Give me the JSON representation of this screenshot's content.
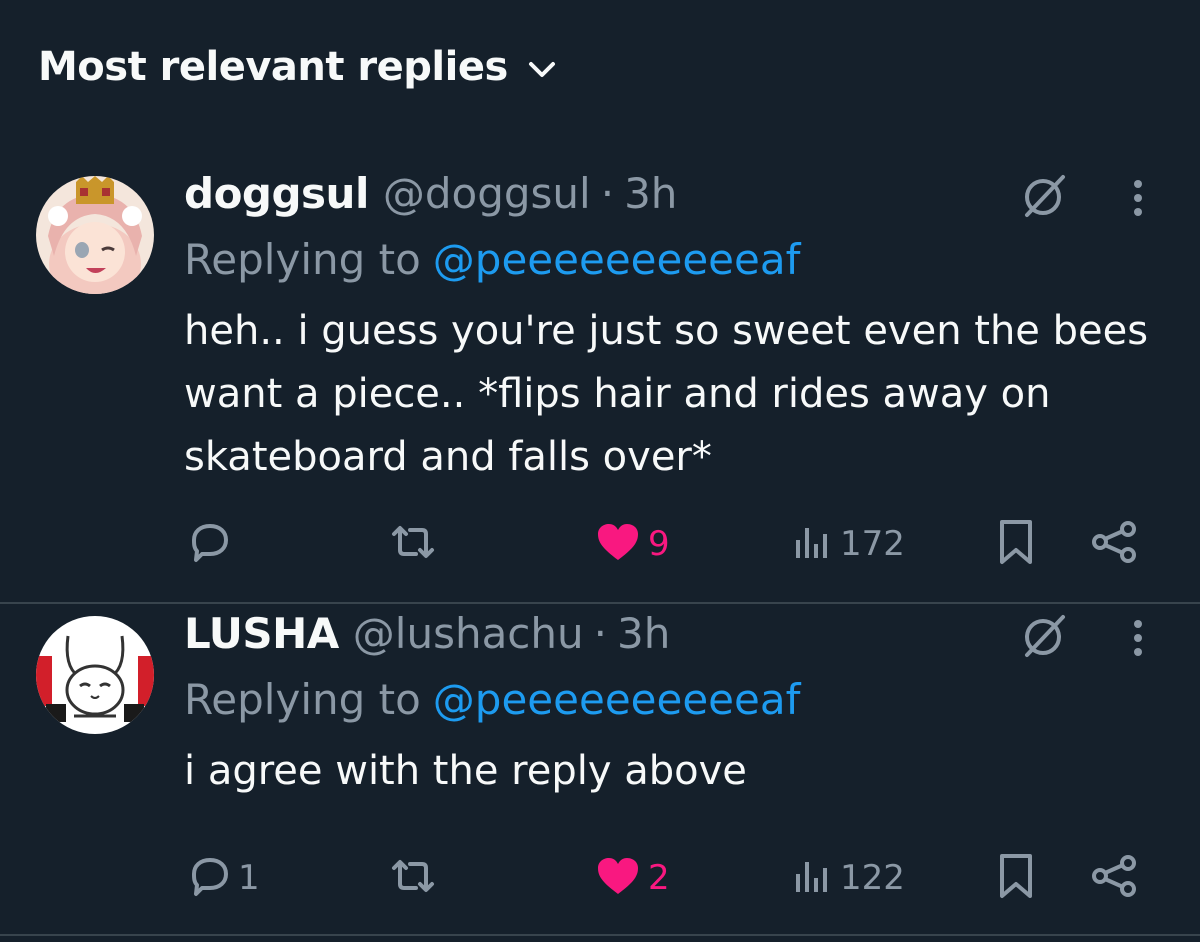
{
  "sort": {
    "label": "Most relevant replies"
  },
  "replies": [
    {
      "display_name": "doggsul",
      "handle": "@doggsul",
      "separator": "·",
      "time": "3h",
      "replying_prefix": "Replying to",
      "replying_handle": "@peeeeeeeeeeaf",
      "text": "heh.. i guess you're just so sweet even the bees want a piece.. *flips hair and rides away on skateboard and falls over*",
      "reply_count": "",
      "retweet_count": "",
      "like_count": "9",
      "view_count": "172"
    },
    {
      "display_name": "LUSHA",
      "handle": "@lushachu",
      "separator": "·",
      "time": "3h",
      "replying_prefix": "Replying to",
      "replying_handle": "@peeeeeeeeeeaf",
      "text": "i agree with the reply above",
      "reply_count": "1",
      "retweet_count": "",
      "like_count": "2",
      "view_count": "122"
    }
  ],
  "icons": {
    "sort": "chevron-down-icon",
    "grok": "grok-icon",
    "more": "more-icon",
    "reply": "reply-icon",
    "retweet": "retweet-icon",
    "like": "heart-icon",
    "views": "views-icon",
    "bookmark": "bookmark-icon",
    "share": "share-icon"
  },
  "colors": {
    "background": "#15202b",
    "text": "#f7f9f9",
    "secondary": "#8b98a5",
    "link": "#1d9bf0",
    "like": "#f91880",
    "divider": "#38444d"
  }
}
